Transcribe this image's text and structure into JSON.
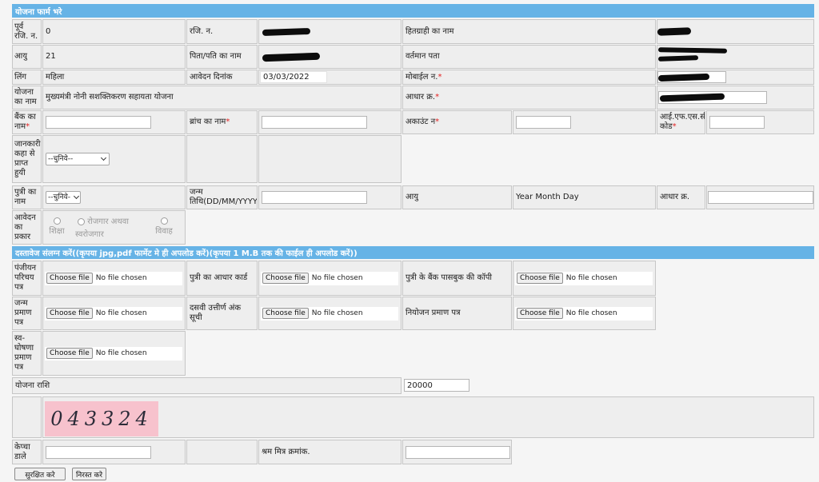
{
  "form": {
    "title": "योजना फार्म भरे",
    "documents_title": "दस्तावेज संलग्न करें((कृपया jpg,pdf फार्मेट मे ही अपलोड करें)(कृपया 1 M.B तक की फाईल ही अपलोड करें))",
    "required_mark": "*"
  },
  "colors": {
    "header_bg": "#66b3e6",
    "required": "#e32222",
    "captcha_bg": "#f7c2cd"
  },
  "icons": {
    "select_arrow": "chevron-down-icon"
  },
  "applicant": {
    "prev_reg_no": {
      "label": "पूर्व रजि. न.",
      "value": "0"
    },
    "reg_no": {
      "label": "रजि. न."
    },
    "beneficiary_name": {
      "label": "हितग्राही का नाम"
    },
    "age": {
      "label": "आयु",
      "value": "21"
    },
    "guardian_name": {
      "label": "पिता/पति का नाम"
    },
    "current_address": {
      "label": "वर्तमान पता"
    },
    "gender": {
      "label": "लिंग",
      "value": "महिला"
    },
    "application_date": {
      "label": "आवेदन दिनांक",
      "value": "03/03/2022"
    },
    "mobile": {
      "label": "मोबाईल न."
    },
    "scheme_name": {
      "label": "योजना का नाम",
      "value": "मुख्यमंत्री नोनी सशक्तिकरण सहायता योजना"
    },
    "aadhaar": {
      "label": "आधार क्र."
    }
  },
  "bank": {
    "bank_name": {
      "label": "बैंक का नाम"
    },
    "branch_name": {
      "label": "ब्रांच का नाम"
    },
    "account_no": {
      "label": "अकाउंट न"
    },
    "ifsc": {
      "label": "आई.एफ.एस.सी कोड"
    }
  },
  "info_source": {
    "label": "जानकारी कहा से प्राप्त हुयी",
    "selected": "--चुनिये--"
  },
  "daughter": {
    "name": {
      "label": "पुत्री का नाम",
      "selected": "--चुनिये-"
    },
    "dob": {
      "label": "जन्म तिथि(DD/MM/YYYY)"
    },
    "age": {
      "label": "आयु",
      "value": "Year Month Day"
    },
    "aadhaar": {
      "label": "आधार क्र."
    }
  },
  "application_type": {
    "label": "आवेदन का प्रकार",
    "options": [
      "शिक्षा",
      "रोजगार अथवा स्वरोजगार",
      "विवाह"
    ]
  },
  "documents": [
    "पंजीयन परिचय पत्र",
    "पुत्री का आधार कार्ड",
    "पुत्री के बैंक पासबुक की कॉपी",
    "जन्म प्रमाण पत्र",
    "दसवी उत्तीर्ण अंक सूची",
    "नियोजन प्रमाण पत्र",
    "स्व-घोषणा प्रमाण पत्र"
  ],
  "file_input": {
    "button": "Choose file",
    "status": "No file chosen"
  },
  "scheme_amount": {
    "label": "योजना राशि",
    "value": "20000"
  },
  "captcha": {
    "image_text": "043324",
    "input_label": "केप्चा डाले"
  },
  "shram_mitra": {
    "label": "श्रम मित्र क्रमांक."
  },
  "buttons": {
    "save": "सुरक्षित करे",
    "cancel": "निरस्त करे"
  }
}
